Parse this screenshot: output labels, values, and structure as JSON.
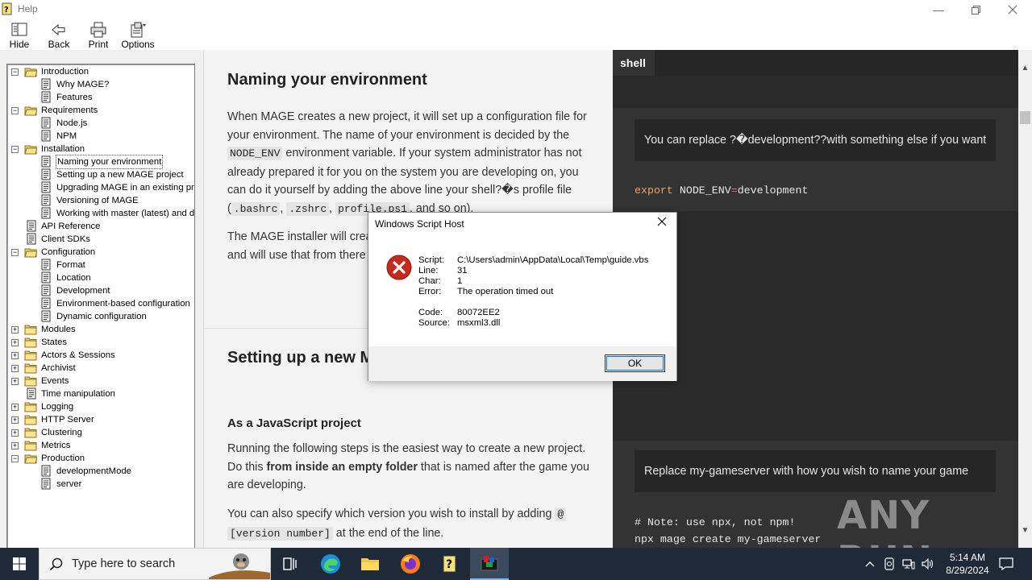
{
  "window": {
    "title": "Help"
  },
  "toolbar": {
    "hide": "Hide",
    "back": "Back",
    "print": "Print",
    "options": "Options"
  },
  "toc": {
    "items": [
      {
        "label": "Introduction",
        "level": 0,
        "expander": "−",
        "icon": "book-open-icon"
      },
      {
        "label": "Why MAGE?",
        "level": 1,
        "icon": "page-icon"
      },
      {
        "label": "Features",
        "level": 1,
        "icon": "page-icon"
      },
      {
        "label": "Requirements",
        "level": 0,
        "expander": "−",
        "icon": "book-open-icon"
      },
      {
        "label": "Node.js",
        "level": 1,
        "icon": "page-icon"
      },
      {
        "label": "NPM",
        "level": 1,
        "icon": "page-icon"
      },
      {
        "label": "Installation",
        "level": 0,
        "expander": "−",
        "icon": "book-open-icon"
      },
      {
        "label": "Naming your environment",
        "level": 1,
        "icon": "page-icon",
        "selected": true
      },
      {
        "label": "Setting up a new MAGE project",
        "level": 1,
        "icon": "page-icon"
      },
      {
        "label": "Upgrading MAGE in an existing proje",
        "level": 1,
        "icon": "page-icon"
      },
      {
        "label": "Versioning of MAGE",
        "level": 1,
        "icon": "page-icon"
      },
      {
        "label": "Working with master (latest) and dev",
        "level": 1,
        "icon": "page-icon"
      },
      {
        "label": "API Reference",
        "level": 0,
        "icon": "page-icon"
      },
      {
        "label": "Client SDKs",
        "level": 0,
        "icon": "page-icon"
      },
      {
        "label": "Configuration",
        "level": 0,
        "expander": "−",
        "icon": "book-open-icon"
      },
      {
        "label": "Format",
        "level": 1,
        "icon": "page-icon"
      },
      {
        "label": "Location",
        "level": 1,
        "icon": "page-icon"
      },
      {
        "label": "Development",
        "level": 1,
        "icon": "page-icon"
      },
      {
        "label": "Environment-based configuration",
        "level": 1,
        "icon": "page-icon"
      },
      {
        "label": "Dynamic configuration",
        "level": 1,
        "icon": "page-icon"
      },
      {
        "label": "Modules",
        "level": 0,
        "expander": "+",
        "icon": "book-closed-icon"
      },
      {
        "label": "States",
        "level": 0,
        "expander": "+",
        "icon": "book-closed-icon"
      },
      {
        "label": "Actors & Sessions",
        "level": 0,
        "expander": "+",
        "icon": "book-closed-icon"
      },
      {
        "label": "Archivist",
        "level": 0,
        "expander": "+",
        "icon": "book-closed-icon"
      },
      {
        "label": "Events",
        "level": 0,
        "expander": "+",
        "icon": "book-closed-icon"
      },
      {
        "label": "Time manipulation",
        "level": 0,
        "icon": "page-icon"
      },
      {
        "label": "Logging",
        "level": 0,
        "expander": "+",
        "icon": "book-closed-icon"
      },
      {
        "label": "HTTP Server",
        "level": 0,
        "expander": "+",
        "icon": "book-closed-icon"
      },
      {
        "label": "Clustering",
        "level": 0,
        "expander": "+",
        "icon": "book-closed-icon"
      },
      {
        "label": "Metrics",
        "level": 0,
        "expander": "+",
        "icon": "book-closed-icon"
      },
      {
        "label": "Production",
        "level": 0,
        "expander": "−",
        "icon": "book-open-icon"
      },
      {
        "label": "developmentMode",
        "level": 1,
        "icon": "page-icon"
      },
      {
        "label": "server",
        "level": 1,
        "icon": "page-icon"
      }
    ]
  },
  "content": {
    "heading1": "Naming your environment",
    "p1": {
      "a": "When MAGE creates a new project, it will set up a configuration file for your environment. The name of your environment is decided by the ",
      "code1": "NODE_ENV",
      "b": " environment variable. If your system administrator has not already prepared it for you on the system you are developing on, you can do it yourself by adding the above line your shell?�s profile file (",
      "code2": ".bashrc",
      "c": ", ",
      "code3": ".zshrc",
      "d": ", ",
      "code4": "profile.ps1",
      "e": ", and so on)."
    },
    "p2_a": "The MAGE installer will crea",
    "p2_b": "and will use that from there o",
    "heading2": "Setting up a new M",
    "heading3": "As a JavaScript project",
    "p3": {
      "a": "Running the following steps is the easiest way to create a new project. Do this ",
      "bold": "from inside an empty folder",
      "b": " that is named after the game you are developing."
    },
    "p4": {
      "a": "You can also specify which version you wish to install by adding ",
      "code1": "@",
      "space": " ",
      "code2": "[version number]",
      "b": " at the end of the line."
    }
  },
  "shell": {
    "tab": "shell",
    "note1": "You can replace ?�development??with something else if you want",
    "cmd1": {
      "kw": "export",
      "name": " NODE_ENV",
      "op": "=",
      "value": "development"
    },
    "note2": "Replace my-gameserver with how you wish to name your game",
    "comment": "# Note: use npx, not npm!",
    "cmd2": "npx mage create my-gameserver"
  },
  "dialog": {
    "title": "Windows Script Host",
    "labels": {
      "script": "Script:",
      "line": "Line:",
      "char": "Char:",
      "error": "Error:",
      "code": "Code:",
      "source": "Source:"
    },
    "values": {
      "script": "C:\\Users\\admin\\AppData\\Local\\Temp\\guide.vbs",
      "line": "31",
      "char": "1",
      "error": "The operation timed out",
      "code": "80072EE2",
      "source": "msxml3.dll"
    },
    "ok": "OK"
  },
  "watermark": "ANY RUN",
  "taskbar": {
    "search_placeholder": "Type here to search",
    "time": "5:14 AM",
    "date": "8/29/2024"
  },
  "colors": {
    "shell_bg": "#333333",
    "shell_keyword": "#f5a35c",
    "taskbar_bg": "#1e2a38",
    "error_red": "#c42b1c"
  }
}
